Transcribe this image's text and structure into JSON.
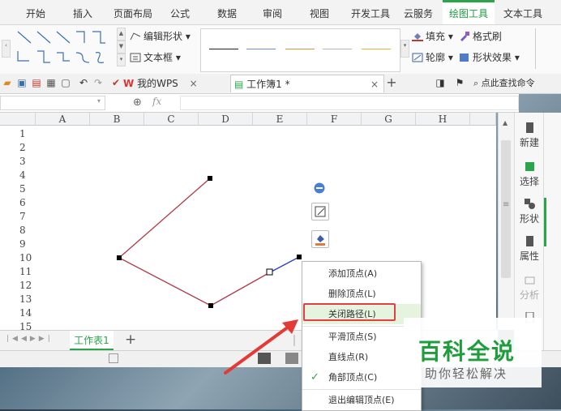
{
  "ribbon": {
    "tabs": [
      "开始",
      "插入",
      "页面布局",
      "公式",
      "数据",
      "审阅",
      "视图",
      "开发工具",
      "云服务",
      "绘图工具",
      "文本工具"
    ],
    "active_tab": "绘图工具",
    "edit_shape_label": "编辑形状",
    "text_box_label": "文本框",
    "fill_label": "填充",
    "format_brush_label": "格式刷",
    "outline_label": "轮廓",
    "shape_effects_label": "形状效果",
    "line_colors": [
      "#222222",
      "#6d8fcf",
      "#d39a3b",
      "#b5b5b5",
      "#e3b52b"
    ]
  },
  "tabbar": {
    "wps_tab": "我的WPS",
    "doc_tab": "工作簿1 *",
    "search_label": "点此查找命令"
  },
  "formula": {
    "fx_label": "fx"
  },
  "sheet": {
    "columns": [
      "A",
      "B",
      "C",
      "D",
      "E",
      "F",
      "G",
      "H"
    ],
    "rows": [
      "1",
      "2",
      "3",
      "4",
      "5",
      "6",
      "7",
      "8",
      "9",
      "10",
      "11",
      "12",
      "13",
      "14",
      "15"
    ],
    "sheet_tab": "工作表1",
    "add_sheet": "+"
  },
  "taskpane": {
    "items": [
      "新建",
      "选择",
      "形状",
      "属性",
      "分析"
    ]
  },
  "context_menu": {
    "items": [
      "添加顶点(A)",
      "删除顶点(L)",
      "关闭路径(L)",
      "平滑顶点(S)",
      "直线点(R)",
      "角部顶点(C)",
      "退出编辑顶点(E)"
    ],
    "highlighted": "关闭路径(L)",
    "checked": "角部顶点(C)"
  },
  "watermark": {
    "title": "百科全说",
    "subtitle": "助你轻松解决"
  }
}
